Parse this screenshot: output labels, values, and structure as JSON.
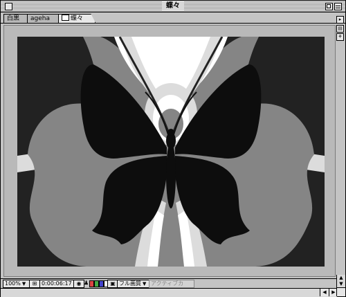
{
  "window": {
    "title": "蝶々"
  },
  "tabs": [
    {
      "label": "白黒",
      "active": false
    },
    {
      "label": "ageha",
      "active": false
    },
    {
      "label": "蝶々",
      "active": true
    }
  ],
  "bottombar": {
    "zoom": "100%",
    "timecode": "0:00:06:17",
    "quality": "フル画質",
    "camera": "アクティブカメ..."
  },
  "colors": {
    "background": "#222222",
    "butterfly": "#0d0d0d",
    "mid_gray": "#858585",
    "light_gray": "#dcdcdc",
    "white": "#ffffff"
  }
}
